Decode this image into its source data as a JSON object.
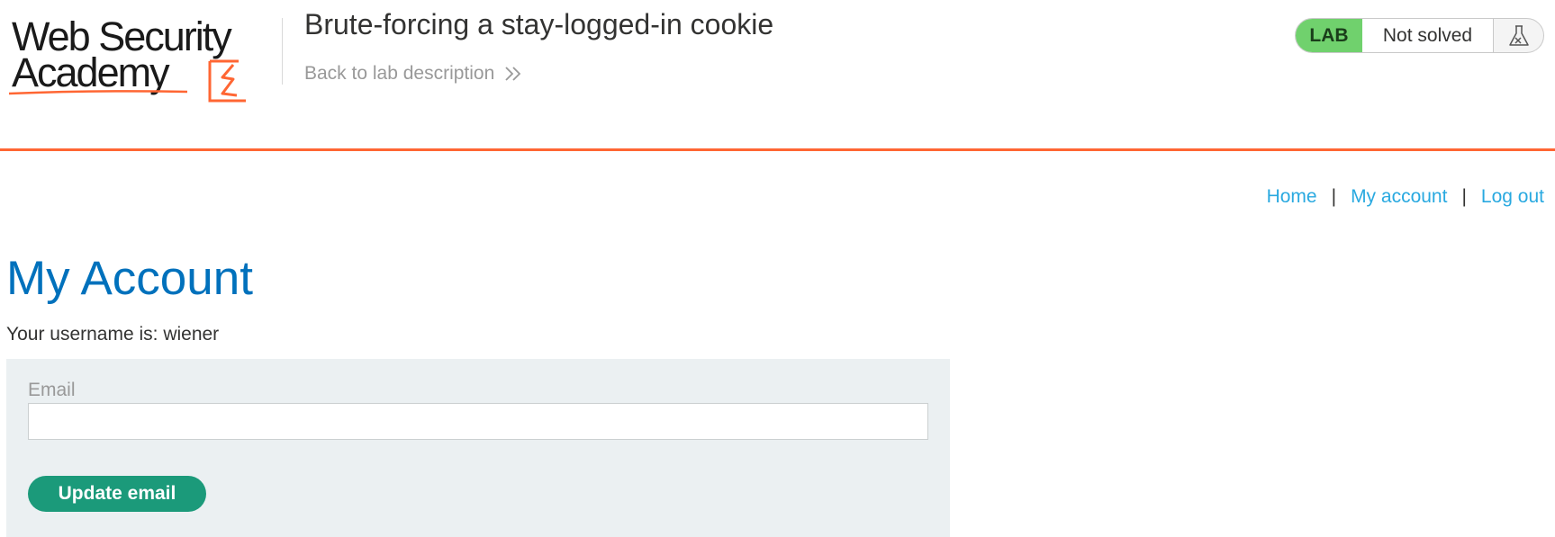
{
  "header": {
    "logo_line1": "Web Security",
    "logo_line2": "Academy",
    "lab_title": "Brute-forcing a stay-logged-in cookie",
    "back_link": "Back to lab description",
    "status": {
      "badge": "LAB",
      "text": "Not solved",
      "icon": "flask-icon"
    }
  },
  "nav": {
    "home": "Home",
    "separator": "|",
    "my_account": "My account",
    "log_out": "Log out"
  },
  "main": {
    "heading": "My Account",
    "username_line": "Your username is: wiener",
    "form": {
      "email_label": "Email",
      "email_value": "",
      "update_button": "Update email"
    }
  },
  "colors": {
    "accent_orange": "#ff6633",
    "link_blue": "#29a9e0",
    "heading_blue": "#0071bc",
    "lab_green": "#70d16d",
    "button_green": "#1b9a7a",
    "panel_bg": "#ebf0f2"
  }
}
